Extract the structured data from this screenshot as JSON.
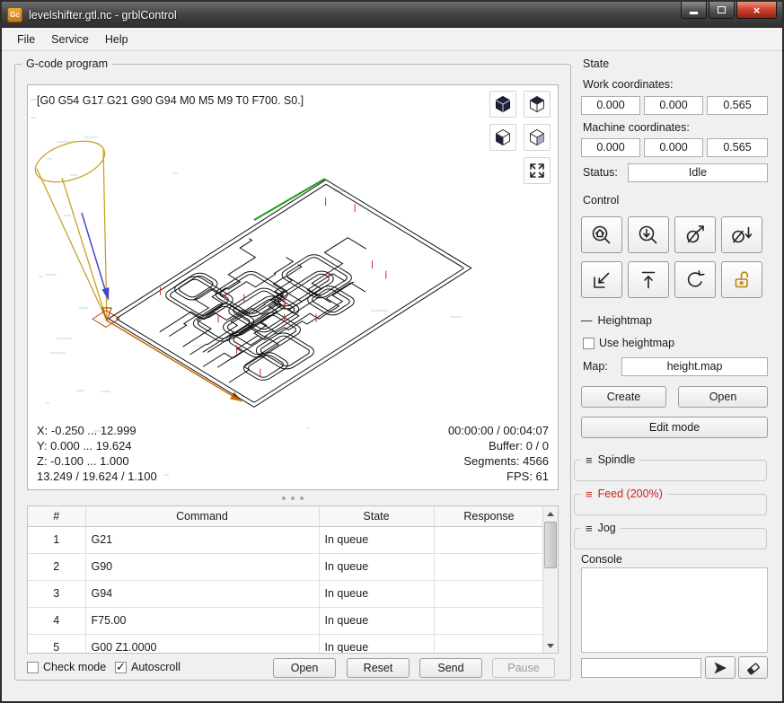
{
  "window": {
    "title": "levelshifter.gtl.nc - grblControl",
    "app_badge": "Gc"
  },
  "menu": {
    "items": [
      {
        "label": "File"
      },
      {
        "label": "Service"
      },
      {
        "label": "Help"
      }
    ]
  },
  "left": {
    "group_label": "G-code program",
    "viewer": {
      "header_line": "[G0 G54 G17 G21 G90 G94 M0 M5 M9 T0 F700. S0.]",
      "bounds": [
        "X: -0.250 ... 12.999",
        "Y: 0.000 ... 19.624",
        "Z: -0.100 ... 1.000",
        "13.249 / 19.624 / 1.100"
      ],
      "stats": [
        "00:00:00 / 00:04:07",
        "Buffer: 0 / 0",
        "Segments: 4566",
        "FPS: 61"
      ],
      "view_buttons": [
        "isometric",
        "top",
        "left",
        "front",
        "fit"
      ]
    },
    "table": {
      "headers": [
        "#",
        "Command",
        "State",
        "Response"
      ],
      "rows": [
        {
          "n": "1",
          "command": "G21",
          "state": "In queue",
          "response": ""
        },
        {
          "n": "2",
          "command": "G90",
          "state": "In queue",
          "response": ""
        },
        {
          "n": "3",
          "command": "G94",
          "state": "In queue",
          "response": ""
        },
        {
          "n": "4",
          "command": "F75.00",
          "state": "In queue",
          "response": ""
        },
        {
          "n": "5",
          "command": "G00 Z1.0000",
          "state": "In queue",
          "response": ""
        }
      ]
    },
    "footer": {
      "check_mode_label": "Check mode",
      "autoscroll_label": "Autoscroll",
      "check_mode_checked": false,
      "autoscroll_checked": true,
      "open_label": "Open",
      "reset_label": "Reset",
      "send_label": "Send",
      "pause_label": "Pause"
    }
  },
  "right": {
    "state": {
      "title": "State",
      "work_label": "Work coordinates:",
      "work": [
        "0.000",
        "0.000",
        "0.565"
      ],
      "machine_label": "Machine coordinates:",
      "machine": [
        "0.000",
        "0.000",
        "0.565"
      ],
      "status_label": "Status:",
      "status_value": "Idle"
    },
    "control": {
      "title": "Control",
      "buttons": [
        "home",
        "z-probe",
        "zero-xy",
        "zero-z",
        "restore-origin",
        "safe-position",
        "reset",
        "unlock"
      ]
    },
    "heightmap": {
      "title": "Heightmap",
      "use_label": "Use heightmap",
      "use_checked": false,
      "map_label": "Map:",
      "map_value": "height.map",
      "create_label": "Create",
      "open_label": "Open",
      "edit_mode_label": "Edit mode"
    },
    "groups": {
      "spindle": "Spindle",
      "feed": "Feed (200%)",
      "jog": "Jog"
    },
    "console": {
      "title": "Console",
      "output": "",
      "input_value": ""
    }
  },
  "colors": {
    "feed_alert": "#c3271c",
    "accent_orange": "#e08a1e"
  }
}
